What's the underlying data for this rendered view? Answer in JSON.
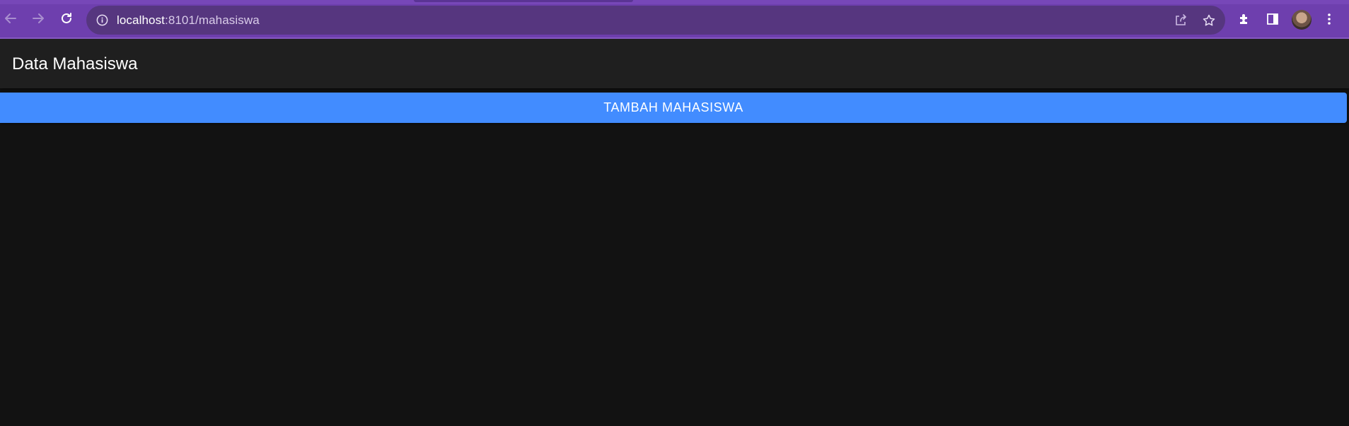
{
  "browser": {
    "url_host": "localhost",
    "url_path": ":8101/mahasiswa",
    "toolbar": {
      "back_icon": "back-arrow-icon",
      "forward_icon": "forward-arrow-icon",
      "reload_icon": "reload-icon",
      "info_icon": "info-icon",
      "share_icon": "share-icon",
      "bookmark_icon": "star-icon",
      "extensions_icon": "puzzle-icon",
      "sidepanel_icon": "side-panel-icon",
      "menu_icon": "kebab-menu-icon"
    },
    "colors": {
      "frame": "#6e3fae",
      "omnibox": "#56367f"
    }
  },
  "app": {
    "title": "Data Mahasiswa",
    "add_button_label": "TAMBAH MAHASISWA",
    "colors": {
      "header": "#1f1f1f",
      "background": "#121212",
      "primary": "#428cff"
    }
  }
}
